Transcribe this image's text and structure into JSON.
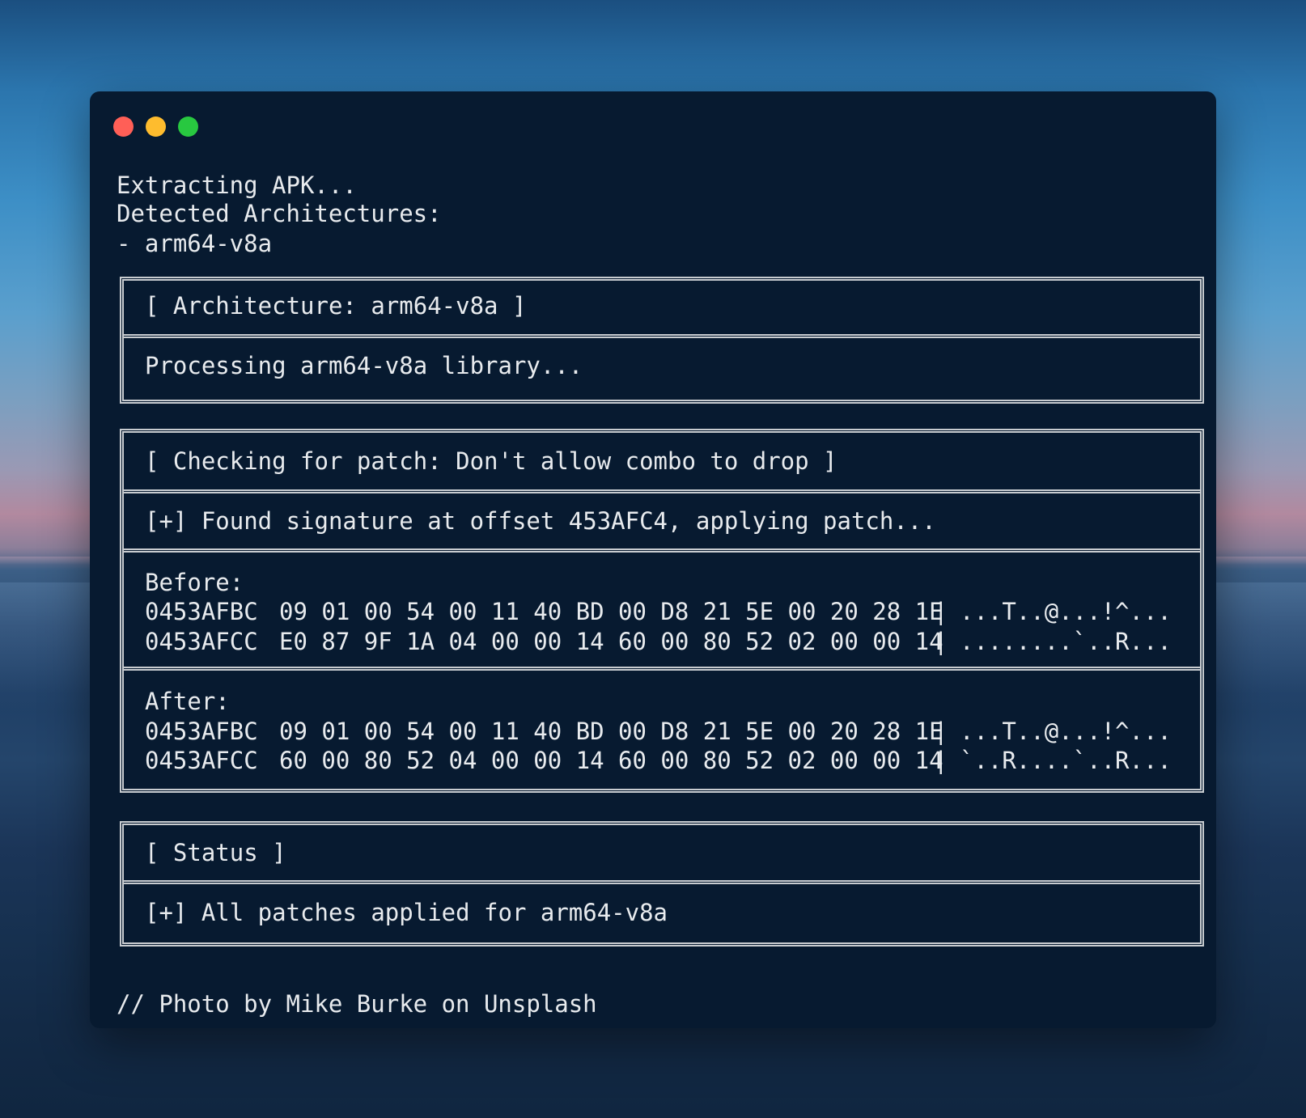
{
  "window": {
    "controls": [
      "close",
      "minimize",
      "zoom"
    ]
  },
  "intro": {
    "line1": "Extracting APK...",
    "line2": "Detected Architectures:",
    "line3": "- arm64-v8a"
  },
  "arch_box": {
    "header": "[ Architecture: arm64-v8a ]",
    "message": "Processing arm64-v8a library..."
  },
  "patch_box": {
    "header": "[ Checking for patch: Don't allow combo to drop ]",
    "found": "[+] Found signature at offset 453AFC4, applying patch...",
    "before": {
      "label": "Before:",
      "rows": [
        {
          "addr": "0453AFBC",
          "bytes": "09 01 00 54 00 11 40 BD 00 D8 21 5E 00 20 28 1E",
          "pipe": "|",
          "ascii": "...T..@...!^..."
        },
        {
          "addr": "0453AFCC",
          "bytes": "E0 87 9F 1A 04 00 00 14 60 00 80 52 02 00 00 14",
          "pipe": "|",
          "ascii": "........`..R..."
        }
      ]
    },
    "after": {
      "label": "After:",
      "rows": [
        {
          "addr": "0453AFBC",
          "bytes": "09 01 00 54 00 11 40 BD 00 D8 21 5E 00 20 28 1E",
          "pipe": "|",
          "ascii": "...T..@...!^..."
        },
        {
          "addr": "0453AFCC",
          "bytes": "60 00 80 52 04 00 00 14 60 00 80 52 02 00 00 14",
          "pipe": "|",
          "ascii": "`..R....`..R..."
        }
      ]
    }
  },
  "status_box": {
    "header": "[ Status ]",
    "message": "[+] All patches applied for arm64-v8a"
  },
  "footer": "// Photo by Mike Burke on Unsplash"
}
